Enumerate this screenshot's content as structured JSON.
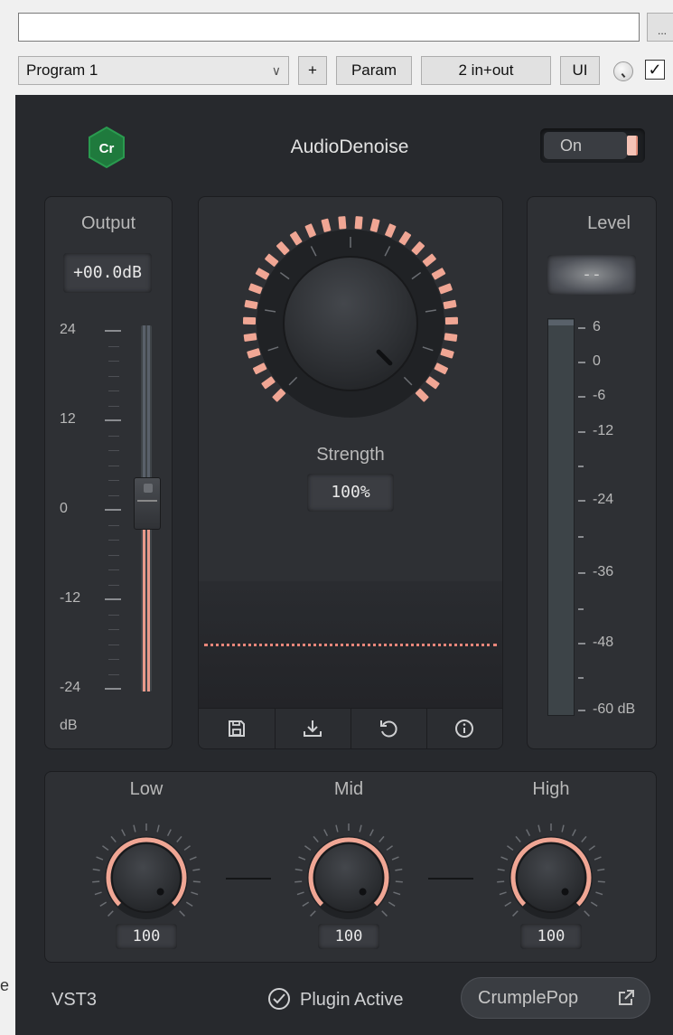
{
  "host": {
    "path_value": "",
    "dots_label": "...",
    "program_selected": "Program 1",
    "plus_label": "+",
    "param_label": "Param",
    "io_label": "2 in+out",
    "ui_label": "UI",
    "checkbox_mark": "✓",
    "side_char": "e"
  },
  "plugin": {
    "logo_text": "Cr",
    "title": "AudioDenoise",
    "power_label": "On"
  },
  "output": {
    "label": "Output",
    "value": "+00.0dB",
    "scale": [
      "24",
      "12",
      "0",
      "-12",
      "-24"
    ],
    "unit": "dB",
    "fader_db": 0
  },
  "strength": {
    "label": "Strength",
    "value": "100%",
    "fraction": 1.0
  },
  "level": {
    "label": "Level",
    "value": "--",
    "scale": [
      "6",
      "0",
      "-6",
      "-12",
      "-24",
      "-36",
      "-48",
      "-60 dB"
    ]
  },
  "bands": [
    {
      "label": "Low",
      "value": "100"
    },
    {
      "label": "Mid",
      "value": "100"
    },
    {
      "label": "High",
      "value": "100"
    }
  ],
  "footer": {
    "format": "VST3",
    "status": "Plugin Active",
    "brand_button": "CrumplePop"
  },
  "colors": {
    "accent": "#f0a694",
    "panel": "#2e3034",
    "background": "#27292d"
  },
  "icons": [
    "save-icon",
    "download-icon",
    "reset-icon",
    "info-icon",
    "check-circle-icon",
    "external-link-icon"
  ]
}
